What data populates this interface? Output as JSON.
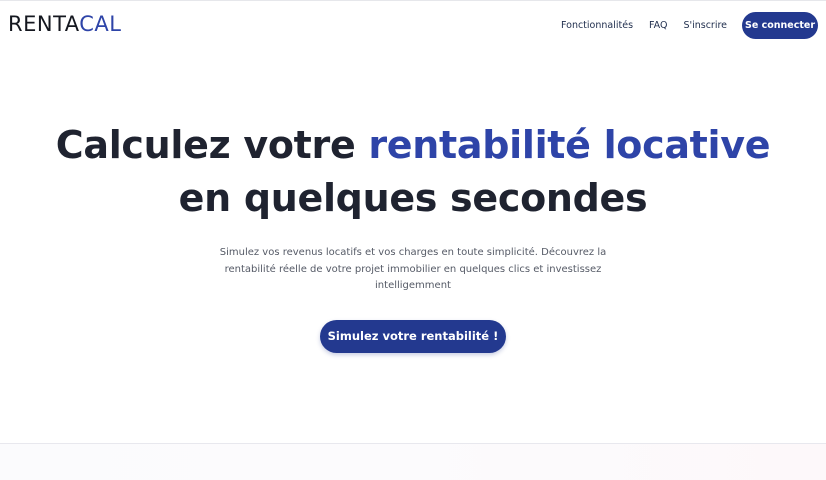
{
  "header": {
    "logo_part1": "RENTA",
    "logo_part2": "CAL",
    "nav": {
      "features": "Fonctionnalités",
      "faq": "FAQ",
      "signup": "S'inscrire",
      "login": "Se connecter"
    }
  },
  "hero": {
    "title_part1": "Calculez votre ",
    "title_highlight": "rentabilité locative",
    "title_part2": "en quelques secondes",
    "subtitle": "Simulez vos revenus locatifs et vos charges en toute simplicité. Découvrez la rentabilité réelle de votre projet immobilier en quelques clics et investissez intelligemment",
    "cta_label": "Simulez votre rentabilité !"
  },
  "colors": {
    "brand": "#23398f",
    "accent": "#2e44a8",
    "text": "#1f2330"
  }
}
